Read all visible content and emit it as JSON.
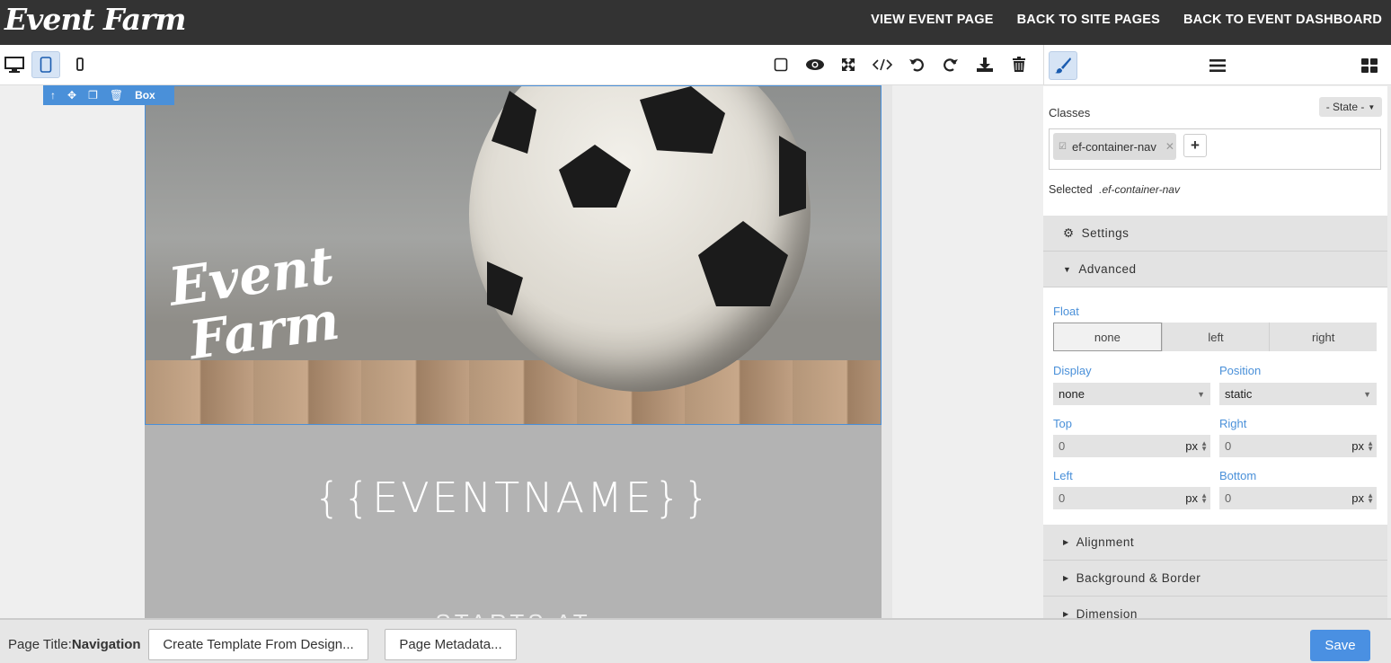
{
  "app": {
    "logo": "Event Farm",
    "nav": [
      "VIEW EVENT PAGE",
      "BACK TO SITE PAGES",
      "BACK TO EVENT DASHBOARD"
    ]
  },
  "toolbar": {
    "devices": [
      "desktop-icon",
      "tablet-icon",
      "mobile-icon"
    ],
    "active_device": "tablet",
    "tools": [
      "outline-square-icon",
      "eye-icon",
      "fullscreen-icon",
      "code-icon",
      "undo-icon",
      "redo-icon",
      "download-icon",
      "trash-icon"
    ]
  },
  "panel_tabs": [
    "brush-icon",
    "layers-icon",
    "blocks-icon"
  ],
  "canvas": {
    "box_label": "Box",
    "hero_logo_line1": "Event",
    "hero_logo_line2": "Farm",
    "event_name": "{{EVENTNAME}}",
    "starts_at": "STARTS AT"
  },
  "style_panel": {
    "classes_label": "Classes",
    "state_select": "- State -",
    "class_chip": "ef-container-nav",
    "selected_label": "Selected",
    "selected_value": ".ef-container-nav",
    "sections": {
      "settings": "Settings",
      "advanced": "Advanced",
      "alignment": "Alignment",
      "background_border": "Background & Border",
      "dimension": "Dimension"
    },
    "advanced": {
      "float_label": "Float",
      "float_options": [
        "none",
        "left",
        "right"
      ],
      "float_selected": "none",
      "display_label": "Display",
      "display_value": "none",
      "position_label": "Position",
      "position_value": "static",
      "top_label": "Top",
      "top_value": "0",
      "right_label": "Right",
      "right_value": "0",
      "left_label": "Left",
      "left_value": "0",
      "bottom_label": "Bottom",
      "bottom_value": "0",
      "unit": "px"
    }
  },
  "bottom": {
    "page_title_label": "Page Title:",
    "page_title_value": "Navigation",
    "create_template": "Create Template From Design...",
    "page_metadata": "Page Metadata...",
    "save": "Save"
  },
  "colors": {
    "accent": "#4a90d9",
    "topbar": "#333333",
    "save": "#4a90e2"
  }
}
